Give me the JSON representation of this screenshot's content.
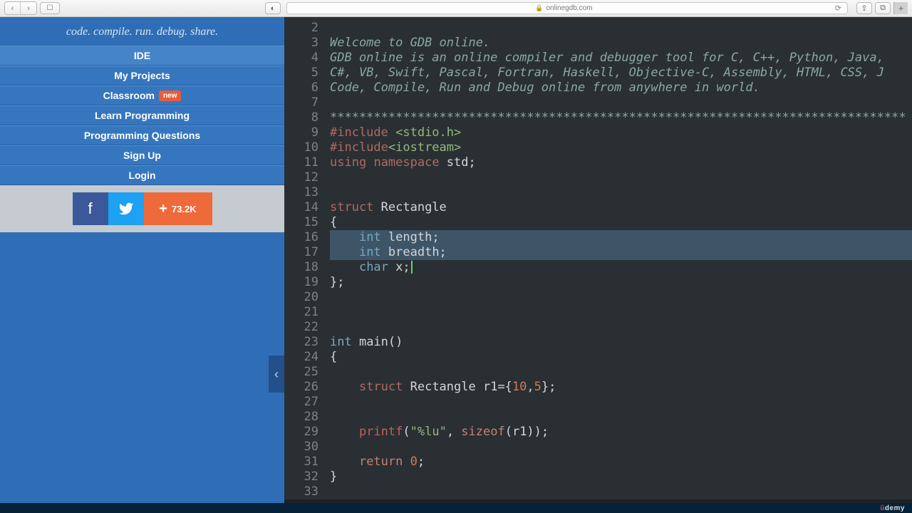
{
  "browser": {
    "url_host": "onlinegdb.com",
    "share_count": "73.2K"
  },
  "sidebar": {
    "tagline": "code. compile. run. debug. share.",
    "items": [
      {
        "label": "IDE",
        "badge": ""
      },
      {
        "label": "My Projects",
        "badge": ""
      },
      {
        "label": "Classroom",
        "badge": "new"
      },
      {
        "label": "Learn Programming",
        "badge": ""
      },
      {
        "label": "Programming Questions",
        "badge": ""
      },
      {
        "label": "Sign Up",
        "badge": ""
      },
      {
        "label": "Login",
        "badge": ""
      }
    ]
  },
  "code": {
    "first_line_no": 2,
    "lines": [
      {
        "n": 2,
        "sel": false,
        "html": ""
      },
      {
        "n": 3,
        "sel": false,
        "html": "<span class='tok-comment'>Welcome to GDB online.</span>"
      },
      {
        "n": 4,
        "sel": false,
        "html": "<span class='tok-comment'>GDB online is an online compiler and debugger tool for C, C++, Python, Java,</span>"
      },
      {
        "n": 5,
        "sel": false,
        "html": "<span class='tok-comment'>C#, VB, Swift, Pascal, Fortran, Haskell, Objective-C, Assembly, HTML, CSS, J</span>"
      },
      {
        "n": 6,
        "sel": false,
        "html": "<span class='tok-comment'>Code, Compile, Run and Debug online from anywhere in world.</span>"
      },
      {
        "n": 7,
        "sel": false,
        "html": ""
      },
      {
        "n": 8,
        "sel": false,
        "html": "<span class='tok-comment'>*******************************************************************************</span>"
      },
      {
        "n": 9,
        "sel": false,
        "html": "<span class='tok-preproc'>#include </span><span class='tok-string'>&lt;stdio.h&gt;</span>"
      },
      {
        "n": 10,
        "sel": false,
        "html": "<span class='tok-preproc'>#include</span><span class='tok-string'>&lt;iostream&gt;</span>"
      },
      {
        "n": 11,
        "sel": false,
        "html": "<span class='tok-keyword'>using</span> <span class='tok-keyword'>namespace</span> std;"
      },
      {
        "n": 12,
        "sel": false,
        "html": ""
      },
      {
        "n": 13,
        "sel": false,
        "html": ""
      },
      {
        "n": 14,
        "sel": false,
        "html": "<span class='tok-keyword'>struct</span> Rectangle"
      },
      {
        "n": 15,
        "sel": false,
        "html": "{"
      },
      {
        "n": 16,
        "sel": true,
        "html": "    <span class='tok-type'>int</span> length;"
      },
      {
        "n": 17,
        "sel": true,
        "html": "    <span class='tok-type'>int</span> breadth;"
      },
      {
        "n": 18,
        "sel": false,
        "html": "    <span class='tok-type'>char</span> x;<span class='cursor'></span>"
      },
      {
        "n": 19,
        "sel": false,
        "html": "};"
      },
      {
        "n": 20,
        "sel": false,
        "html": ""
      },
      {
        "n": 21,
        "sel": false,
        "html": ""
      },
      {
        "n": 22,
        "sel": false,
        "html": ""
      },
      {
        "n": 23,
        "sel": false,
        "html": "<span class='tok-type'>int</span> main()"
      },
      {
        "n": 24,
        "sel": false,
        "html": "{"
      },
      {
        "n": 25,
        "sel": false,
        "html": ""
      },
      {
        "n": 26,
        "sel": false,
        "html": "    <span class='tok-keyword'>struct</span> Rectangle r1={<span class='tok-number'>10</span>,<span class='tok-number'>5</span>};"
      },
      {
        "n": 27,
        "sel": false,
        "html": ""
      },
      {
        "n": 28,
        "sel": false,
        "html": ""
      },
      {
        "n": 29,
        "sel": false,
        "html": "    <span class='tok-func'>printf</span>(<span class='tok-string'>\"%lu\"</span>, <span class='tok-keyword2'>sizeof</span>(r1));"
      },
      {
        "n": 30,
        "sel": false,
        "html": ""
      },
      {
        "n": 31,
        "sel": false,
        "html": "    <span class='tok-ret'>return</span> <span class='tok-number'>0</span>;"
      },
      {
        "n": 32,
        "sel": false,
        "html": "}"
      },
      {
        "n": 33,
        "sel": false,
        "html": ""
      }
    ]
  },
  "footer": {
    "brand": "demy"
  }
}
